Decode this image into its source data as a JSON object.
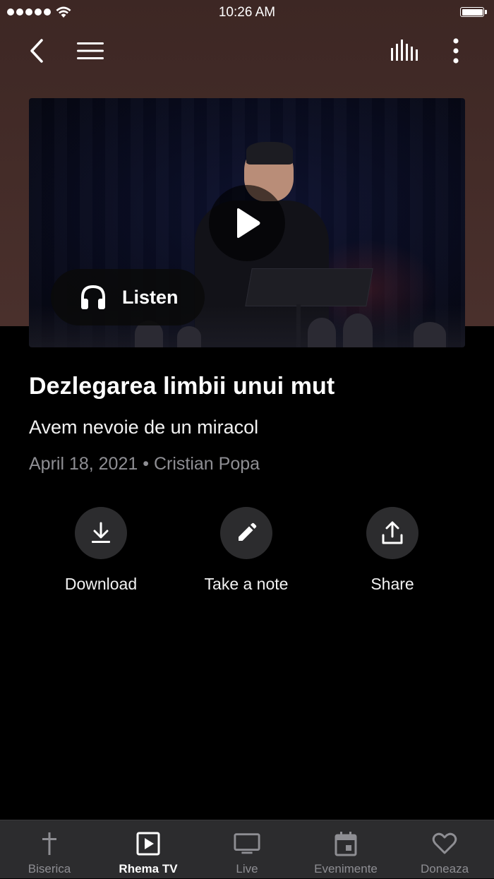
{
  "status_bar": {
    "time": "10:26 AM"
  },
  "sermon": {
    "title": "Dezlegarea limbii unui mut",
    "series": "Avem nevoie de un miracol",
    "date": "April 18, 2021",
    "separator": "•",
    "speaker": "Cristian Popa"
  },
  "player": {
    "listen_label": "Listen"
  },
  "actions": [
    {
      "label": "Download",
      "icon": "download-icon"
    },
    {
      "label": "Take a note",
      "icon": "pencil-icon"
    },
    {
      "label": "Share",
      "icon": "share-icon"
    }
  ],
  "tabs": [
    {
      "label": "Biserica",
      "icon": "cross-icon",
      "active": false
    },
    {
      "label": "Rhema TV",
      "icon": "play-square-icon",
      "active": true
    },
    {
      "label": "Live",
      "icon": "tv-icon",
      "active": false
    },
    {
      "label": "Evenimente",
      "icon": "calendar-icon",
      "active": false
    },
    {
      "label": "Doneaza",
      "icon": "heart-icon",
      "active": false
    }
  ],
  "colors": {
    "header_background": "#4a302c",
    "page_background": "#000000",
    "tab_bar_background": "#2c2c2e",
    "inactive_text": "#8e8e93"
  }
}
